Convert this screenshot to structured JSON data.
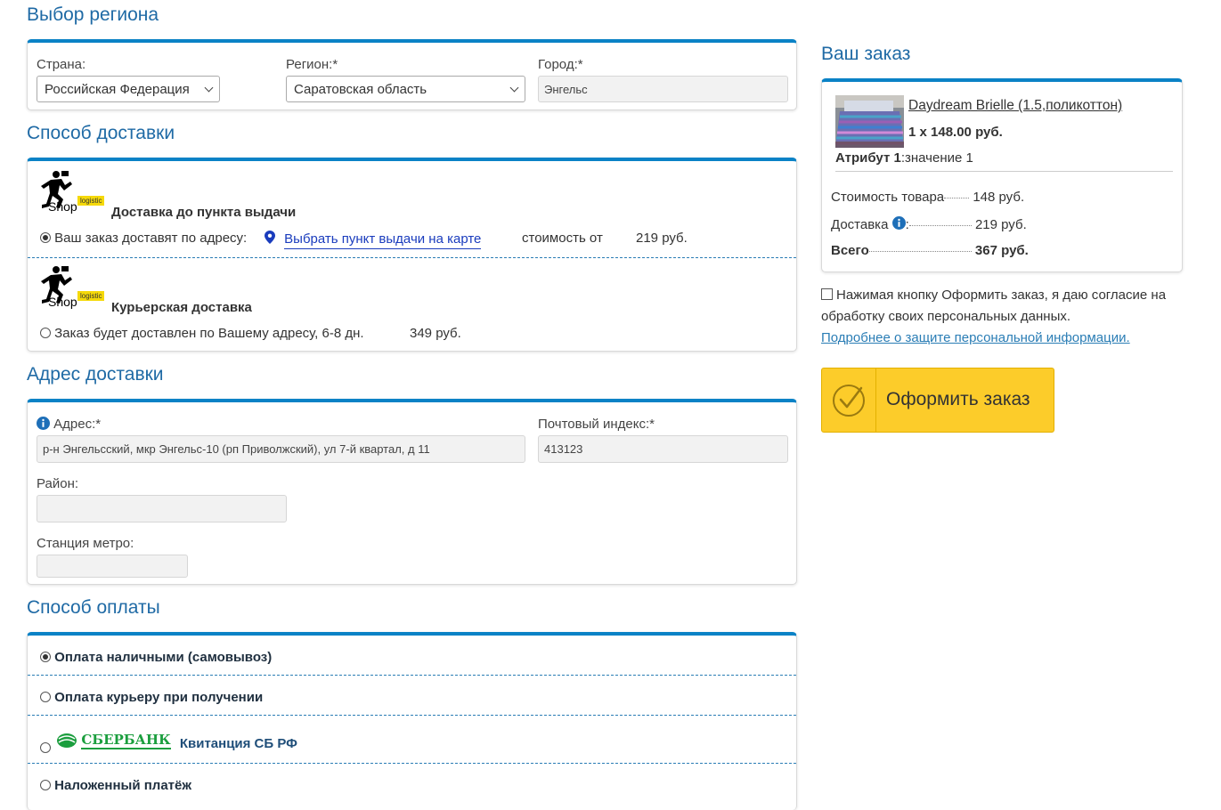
{
  "region": {
    "title": "Выбор региона",
    "country_label": "Страна:",
    "country_value": "Российская Федерация",
    "region_label": "Регион:*",
    "region_value": "Саратовская область",
    "city_label": "Город:*",
    "city_value": "Энгельс"
  },
  "delivery": {
    "title": "Способ доставки",
    "options": [
      {
        "logo_text": "Shop",
        "logo_tag": "logistic",
        "name": "Доставка до пункта выдачи",
        "desc": "Ваш заказ доставят по адресу:",
        "link": "Выбрать пункт выдачи на карте",
        "cost_label": "стоимость от",
        "price": "219 руб.",
        "selected": true
      },
      {
        "logo_text": "Shop",
        "logo_tag": "logistic",
        "name": "Курьерская доставка",
        "desc": "Заказ будет доставлен по Вашему адресу, 6-8 дн.",
        "price": "349 руб.",
        "selected": false
      }
    ]
  },
  "address": {
    "title": "Адрес доставки",
    "address_label": "Адрес:*",
    "address_value": "р-н Энгельсский, мкр Энгельс-10 (рп Приволжский), ул 7-й квартал, д 11",
    "zip_label": "Почтовый индекс:*",
    "zip_value": "413123",
    "district_label": "Район:",
    "district_value": "",
    "metro_label": "Станция метро:",
    "metro_value": ""
  },
  "payment": {
    "title": "Способ оплаты",
    "options": [
      {
        "label": "Оплата наличными (самовывоз)",
        "selected": true
      },
      {
        "label": "Оплата курьеру при получении",
        "selected": false
      },
      {
        "logo": "СБЕРБАНК",
        "label": "Квитанция СБ РФ",
        "selected": false
      },
      {
        "label": "Наложенный платёж",
        "selected": false
      }
    ]
  },
  "order": {
    "title": "Ваш заказ",
    "item_name": "Daydream Brielle (1.5,поликоттон)",
    "item_qty_price": "1 x 148.00 руб.",
    "attr_label": "Атрибут 1",
    "attr_value": ":значение 1",
    "goods_label": "Стоимость товара",
    "goods_value": "148 руб.",
    "delivery_label": "Доставка",
    "delivery_value": "219 руб.",
    "total_label": "Всего",
    "total_value": "367 руб."
  },
  "consent": {
    "text": "Нажимая кнопку Оформить заказ, я даю согласие на обработку своих персональных данных.",
    "link": "Подробнее о защите персональной информации."
  },
  "checkout_button": "Оформить заказ",
  "colors": {
    "accent": "#0a82c6",
    "heading": "#1f6aa5",
    "button": "#fccc2a",
    "sber_green": "#1b9e3e"
  }
}
